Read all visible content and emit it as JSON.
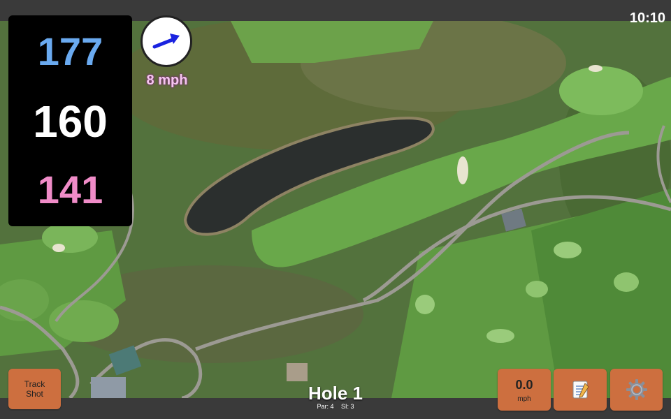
{
  "status": {
    "time": "10:10"
  },
  "distances": {
    "back": "177",
    "center": "160",
    "front": "141"
  },
  "wind": {
    "speed_text": "8 mph",
    "direction_icon": "arrow-up-right-icon"
  },
  "hole": {
    "title": "Hole 1",
    "par": "Par: 4",
    "si": "SI: 3"
  },
  "buttons": {
    "track_shot_line1": "Track",
    "track_shot_line2": "Shot",
    "wind_value": "0.0",
    "wind_unit": "mph",
    "notes_icon": "memo-icon",
    "settings_icon": "gear-icon"
  },
  "colors": {
    "back_distance": "#6aaaf0",
    "center_distance": "#ffffff",
    "front_distance": "#f08cc8",
    "button_accent": "#cd6f3f",
    "wind_arrow": "#1a23e0"
  }
}
